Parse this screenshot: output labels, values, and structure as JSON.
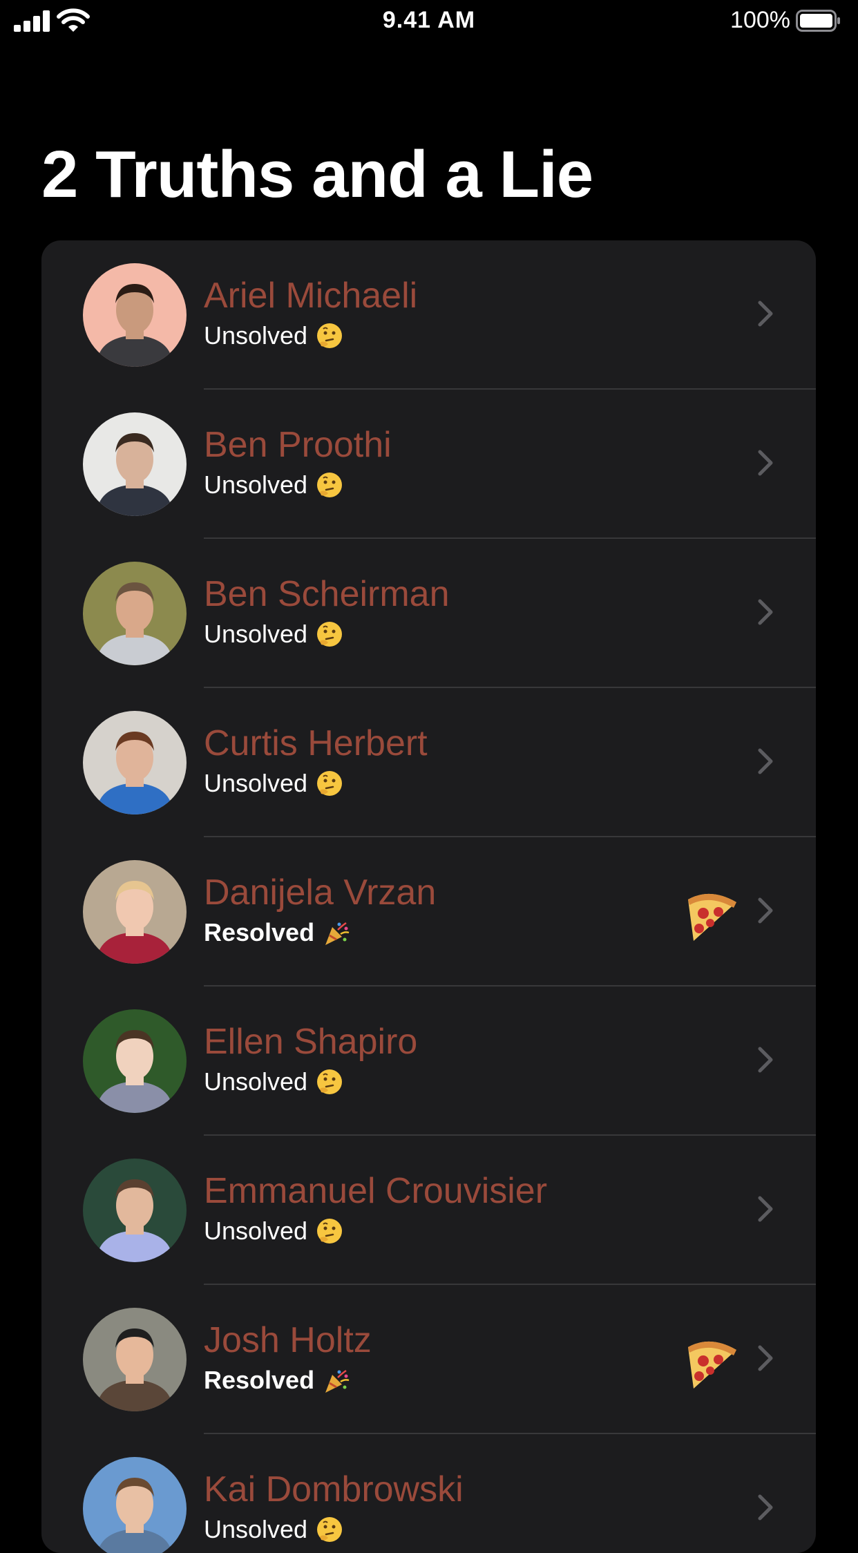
{
  "status_bar": {
    "time": "9.41 AM",
    "battery_percent": "100%",
    "signal_icon": "cellular-signal-icon",
    "wifi_icon": "wifi-icon",
    "battery_icon": "battery-full-icon"
  },
  "title": "2 Truths and a Lie",
  "colors": {
    "name": "#9a4a3b",
    "card_background": "#1c1c1e",
    "background": "#000000"
  },
  "people": [
    {
      "name": "Ariel Michaeli",
      "status": "Unsolved",
      "status_icon": "thinking-face-icon",
      "pizza": false,
      "skin": "#c99a7d",
      "hair": "#2a1c15",
      "shirt": "#3a3a3e",
      "bg": "#f4b9a8"
    },
    {
      "name": "Ben Proothi",
      "status": "Unsolved",
      "status_icon": "thinking-face-icon",
      "pizza": false,
      "skin": "#d8b29a",
      "hair": "#3a2a20",
      "shirt": "#2f3440",
      "bg": "#e8e8e6"
    },
    {
      "name": "Ben Scheirman",
      "status": "Unsolved",
      "status_icon": "thinking-face-icon",
      "pizza": false,
      "skin": "#d9a88a",
      "hair": "#6b5440",
      "shirt": "#c9ccd2",
      "bg": "#8c8a4e"
    },
    {
      "name": "Curtis Herbert",
      "status": "Unsolved",
      "status_icon": "thinking-face-icon",
      "pizza": false,
      "skin": "#e0b49a",
      "hair": "#6a3a22",
      "shirt": "#2f6fc4",
      "bg": "#d6d2cc"
    },
    {
      "name": "Danijela Vrzan",
      "status": "Resolved",
      "status_icon": "party-popper-icon",
      "pizza": true,
      "pizza_icon": "pizza-icon",
      "skin": "#f0c8b0",
      "hair": "#e6c590",
      "shirt": "#a8223a",
      "bg": "#b8a892"
    },
    {
      "name": "Ellen Shapiro",
      "status": "Unsolved",
      "status_icon": "thinking-face-icon",
      "pizza": false,
      "skin": "#f0d2be",
      "hair": "#4a3424",
      "shirt": "#8a8fa8",
      "bg": "#2f5a2a"
    },
    {
      "name": "Emmanuel Crouvisier",
      "status": "Unsolved",
      "status_icon": "thinking-face-icon",
      "pizza": false,
      "skin": "#e2b89c",
      "hair": "#5a4030",
      "shirt": "#a9b2e8",
      "bg": "#2a4a3a"
    },
    {
      "name": "Josh Holtz",
      "status": "Resolved",
      "status_icon": "party-popper-icon",
      "pizza": true,
      "pizza_icon": "pizza-icon",
      "skin": "#e6b89a",
      "hair": "#1f1f1f",
      "shirt": "#5a4638",
      "bg": "#8a8a80"
    },
    {
      "name": "Kai Dombrowski",
      "status": "Unsolved",
      "status_icon": "thinking-face-icon",
      "pizza": false,
      "skin": "#e8c0a4",
      "hair": "#6a4a30",
      "shirt": "#5a7aa0",
      "bg": "#6a9ad0"
    }
  ]
}
